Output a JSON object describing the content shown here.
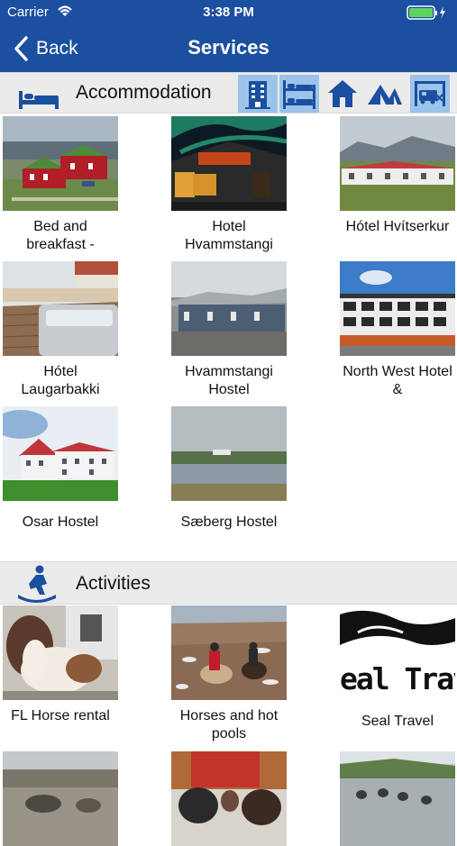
{
  "status_bar": {
    "carrier": "Carrier",
    "time": "3:38 PM"
  },
  "nav": {
    "back_label": "Back",
    "title": "Services"
  },
  "accommodation": {
    "title": "Accommodation",
    "filters": [
      {
        "name": "hotel-icon",
        "active": true
      },
      {
        "name": "hostel-bunk-icon",
        "active": true
      },
      {
        "name": "house-icon",
        "active": false
      },
      {
        "name": "camping-tent-icon",
        "active": false
      },
      {
        "name": "no-rv-icon",
        "active": true
      }
    ],
    "items": [
      {
        "title": "Bed and breakfast -"
      },
      {
        "title": "Hotel Hvammstangi"
      },
      {
        "title": "Hótel Hvítserkur"
      },
      {
        "title": "Hótel Laugarbakki"
      },
      {
        "title": "Hvammstangi Hostel"
      },
      {
        "title": "North West Hotel &"
      },
      {
        "title": "Osar Hostel"
      },
      {
        "title": "Sæberg Hostel"
      }
    ]
  },
  "activities": {
    "title": "Activities",
    "items": [
      {
        "title": "FL Horse rental"
      },
      {
        "title": "Horses and hot pools"
      },
      {
        "title": "Seal Travel",
        "logo_text": "eal Trav"
      },
      {
        "title": ""
      },
      {
        "title": ""
      },
      {
        "title": ""
      }
    ]
  }
}
